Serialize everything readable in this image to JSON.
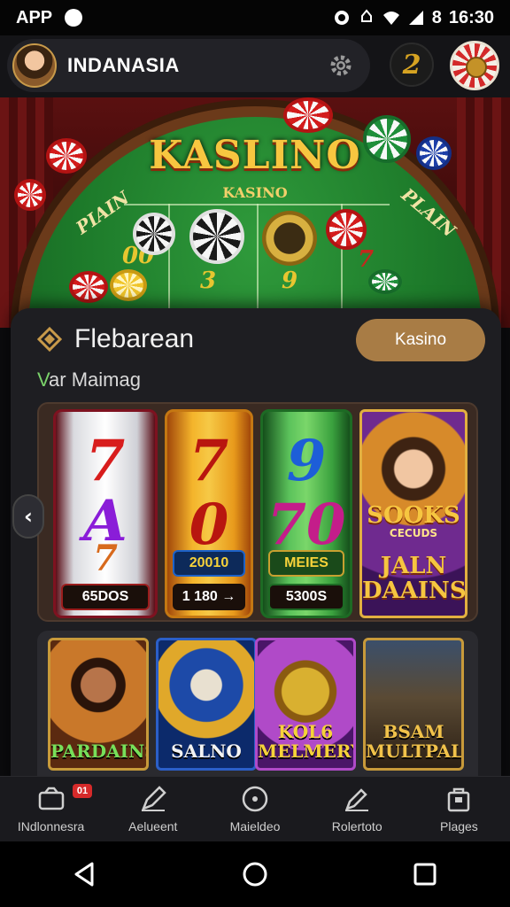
{
  "status_bar": {
    "carrier": "APP",
    "time": "16:30",
    "battery_text": "8"
  },
  "header": {
    "app_name": "INDANASIA",
    "badge_glyph": "2",
    "icons": [
      "avatar",
      "gear-icon",
      "roulette-icon"
    ]
  },
  "hero": {
    "title": "KASLINO",
    "subtitle": "KASINO",
    "felt_left": "PIAIN",
    "felt_right": "PLAIN",
    "felt_numbers": [
      "00",
      "3",
      "9",
      "7"
    ]
  },
  "panel": {
    "title": "Flebarean",
    "subtitle_prefix": "V",
    "subtitle_rest": "ar Maimag",
    "action_label": "Kasino",
    "slots": [
      {
        "symbols": [
          "7",
          "A",
          "7"
        ],
        "label": "65DOS"
      },
      {
        "symbols": [
          "7",
          "0"
        ],
        "label": "20010"
      },
      {
        "symbols": [
          "9",
          "70"
        ],
        "label": "MEIES"
      }
    ],
    "slot_footer": [
      "65DOS",
      "1 180 →",
      "5300S"
    ],
    "promo": {
      "line1": "SOOKS",
      "line2": "CECUDS",
      "line3": "JALN DAAINS"
    }
  },
  "games": [
    {
      "title": "PARDAINS"
    },
    {
      "title": "SALNO"
    },
    {
      "title": "KOL6 MELMERY"
    },
    {
      "title": "BSAM MULTPALIN"
    }
  ],
  "bottom_nav": {
    "items": [
      {
        "label": "INdlonnesra",
        "badge": "01"
      },
      {
        "label": "Aelueent"
      },
      {
        "label": "Maieldeo"
      },
      {
        "label": "Rolertoto"
      },
      {
        "label": "Plages"
      }
    ]
  },
  "colors": {
    "accent": "#a87c45",
    "felt": "#1d7a2a",
    "gold": "#f7c640",
    "panel": "#1e1e22"
  }
}
